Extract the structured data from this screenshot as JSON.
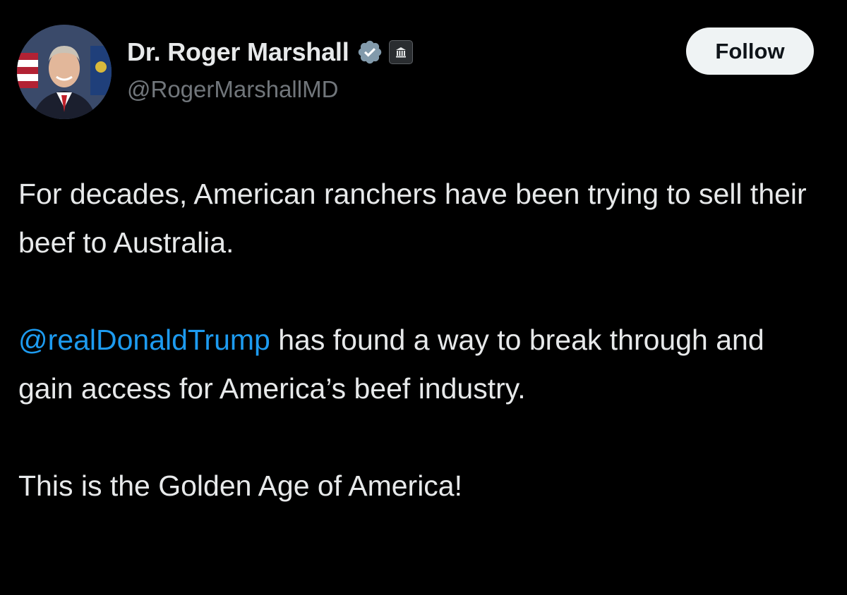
{
  "author": {
    "display_name": "Dr. Roger Marshall",
    "handle": "@RogerMarshallMD",
    "avatar_icon": "profile-photo",
    "verified_icon": "verified-badge-icon",
    "affiliation_icon": "government-building-icon"
  },
  "actions": {
    "follow_label": "Follow"
  },
  "tweet": {
    "paragraph_1": "For decades, American ranchers have been trying to sell their beef to Australia.",
    "paragraph_2_mention": "@realDonaldTrump",
    "paragraph_2_rest": " has found a way to break through and gain access for America’s beef industry.",
    "paragraph_3": "This is the Golden Age of America!"
  },
  "colors": {
    "background": "#000000",
    "text": "#e7e9ea",
    "secondary_text": "#71767b",
    "link": "#1d9bf0",
    "verified_badge": "#829aab",
    "follow_button_bg": "#eff3f4"
  }
}
